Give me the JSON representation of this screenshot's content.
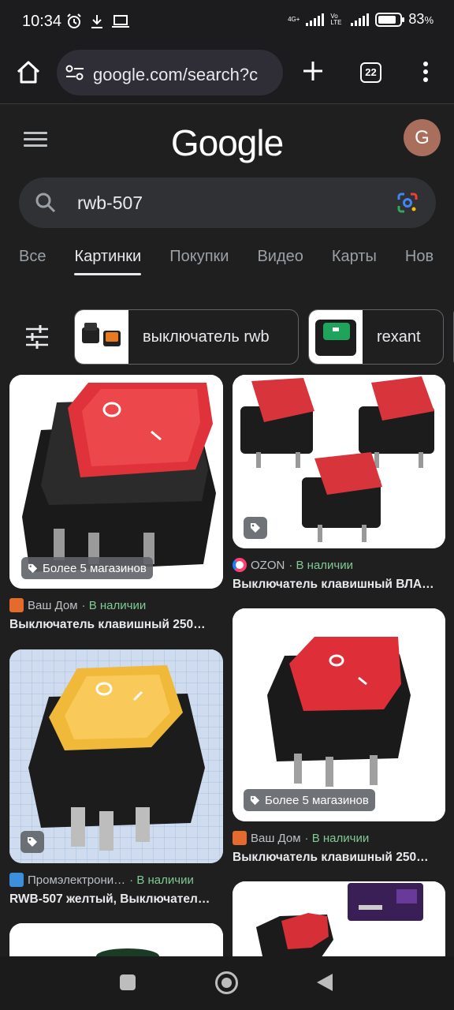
{
  "status_bar": {
    "time": "10:34",
    "network_label": "4G+",
    "volte_label": "Vo LTE",
    "battery": "83",
    "battery_unit": "%",
    "battery_level": 0.83
  },
  "browser": {
    "url": "google.com/search?c",
    "tab_count": "22"
  },
  "google": {
    "logo": "Google",
    "avatar_letter": "G",
    "search_query": "rwb-507"
  },
  "tabs": [
    {
      "label": "Все",
      "active": false
    },
    {
      "label": "Картинки",
      "active": true
    },
    {
      "label": "Покупки",
      "active": false
    },
    {
      "label": "Видео",
      "active": false
    },
    {
      "label": "Карты",
      "active": false
    },
    {
      "label": "Нов",
      "active": false
    }
  ],
  "chips": [
    {
      "label": "выключатель rwb"
    },
    {
      "label": "rexant"
    }
  ],
  "results": [
    {
      "badge": "Более 5 магазинов",
      "source": "Ваш Дом",
      "stock": "· В наличии",
      "title": "Выключатель клавишный 250…",
      "rocker_color": "#e0323a"
    },
    {
      "badge": "",
      "source": "OZON",
      "stock": "· В наличии",
      "title": "Выключатель клавишный ВЛА…",
      "rocker_color": "#d8343b"
    },
    {
      "badge": "",
      "source": "Промэлектрони…",
      "stock": "· В наличии",
      "title": "RWB-507 желтый, Выключател…",
      "rocker_color": "#f0b93a"
    },
    {
      "badge": "Более 5 магазинов",
      "source": "Ваш Дом",
      "stock": "· В наличии",
      "title": "Выключатель клавишный 250…",
      "rocker_color": "#de2e38"
    }
  ],
  "colors": {
    "background": "#1f1f1f",
    "in_stock": "#81c995",
    "searchbox": "#303134"
  }
}
